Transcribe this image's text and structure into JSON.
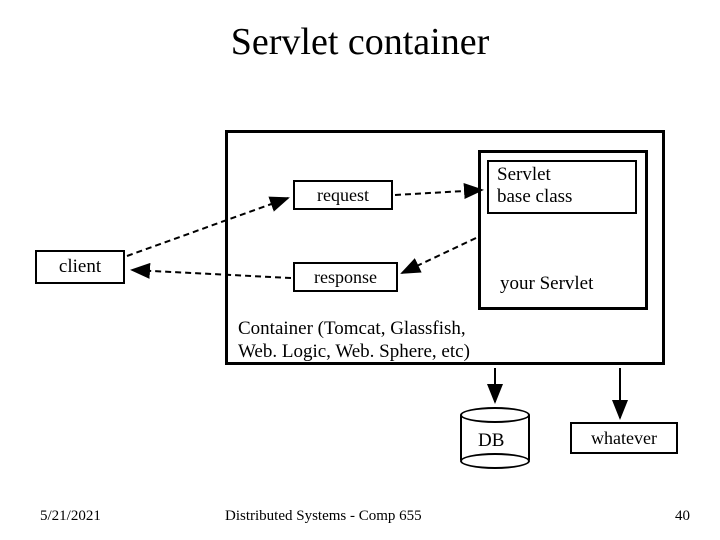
{
  "title": "Servlet container",
  "boxes": {
    "client": "client",
    "request": "request",
    "response": "response",
    "servlet_base": "Servlet\nbase class",
    "your_servlet": "your Servlet",
    "container_label": "Container (Tomcat, Glassfish,\nWeb. Logic, Web. Sphere, etc)",
    "db": "DB",
    "whatever": "whatever"
  },
  "footer": {
    "date": "5/21/2021",
    "course": "Distributed Systems - Comp 655",
    "page": "40"
  }
}
